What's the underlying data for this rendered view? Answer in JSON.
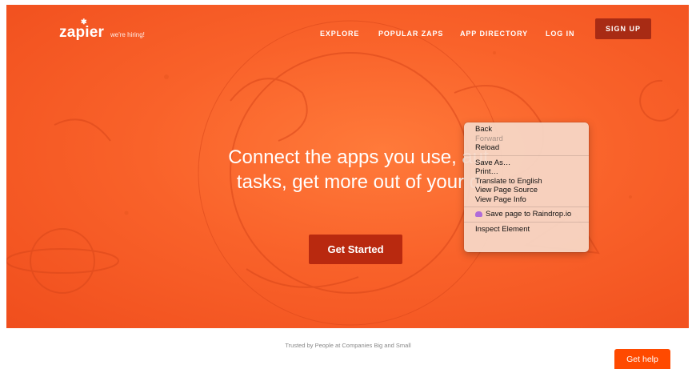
{
  "header": {
    "logo": "zapier",
    "logo_star": "✱",
    "hiring": "we're hiring!",
    "nav": [
      "EXPLORE",
      "POPULAR ZAPS",
      "APP DIRECTORY",
      "LOG IN"
    ],
    "signup": "SIGN UP"
  },
  "hero": {
    "headline_line1": "Connect the apps you use, aut",
    "headline_line2": "tasks, get more out of your d",
    "cta": "Get Started"
  },
  "context_menu": {
    "group1": [
      "Back",
      "Forward",
      "Reload"
    ],
    "group2": [
      "Save As…",
      "Print…",
      "Translate to English",
      "View Page Source",
      "View Page Info"
    ],
    "group3": [
      "Save page to Raindrop.io"
    ],
    "group4": [
      "Inspect Element"
    ],
    "disabled_item": "Forward",
    "raindrop_icon": "raindrop-cloud-icon"
  },
  "footer": {
    "trusted": "Trusted by People at Companies Big and Small",
    "get_help": "Get help"
  },
  "colors": {
    "brand_orange": "#ff4a00",
    "hero_orange": "#f9622a",
    "button_dark": "#b9290f"
  }
}
